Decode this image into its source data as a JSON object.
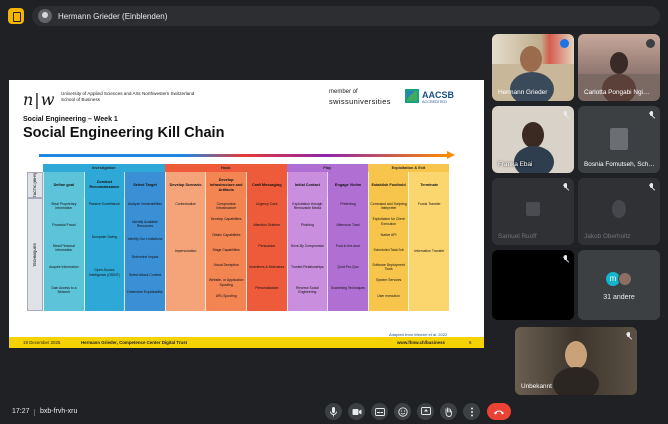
{
  "top_bar": {
    "presenter_label": "Hermann Grieder (Einblenden)"
  },
  "slide": {
    "logo": "n|w",
    "university_lines": [
      "University of Applied Sciences and Arts Northwestern Switzerland",
      "School of Business"
    ],
    "member_of": "member of",
    "swissuniversities": "swissuniversities",
    "aacsb": "AACSB",
    "aacsb_sub": "ACCREDITED",
    "subtitle": "Social Engineering – Week 1",
    "title": "Social Engineering Kill Chain",
    "side_tactic": "TACTIC (WHY)",
    "side_technique": "TECHNIQUES",
    "phases": [
      "Investigation",
      "Hook",
      "Play",
      "Exploitation & Exit"
    ],
    "columns": [
      {
        "header": "Define goal",
        "color": "#5cc3d8",
        "techniques": [
          "Steal Proprietary Information",
          "Financial Fraud",
          "Steal Personal Information",
          "Acquire Information",
          "Gain Access to a Network"
        ]
      },
      {
        "header": "Conduct Reconnaissance",
        "color": "#2ea8d6",
        "techniques": [
          "Passive Surveillance",
          "Dumpster Diving",
          "Open-Source Intelligence (OSINT)"
        ]
      },
      {
        "header": "Select Target",
        "color": "#3b8fd4",
        "techniques": [
          "Analyze Vulnerabilities",
          "Identify Available Resources",
          "Identify Our Limitations",
          "Determine Impact",
          "Select Attack Context",
          "Determine Exploitability"
        ]
      },
      {
        "header": "Develop Scenario",
        "color": "#f5a47a",
        "techniques": [
          "Contextualize",
          "Impersonation"
        ]
      },
      {
        "header": "Develop Infrastructure and Artifacts",
        "color": "#f28552",
        "techniques": [
          "Compromise Infrastructure",
          "Develop Capabilities",
          "Obtain Capabilities",
          "Stage Capabilities",
          "Visual Deception",
          "Website- or Application Spoofing",
          "URL Spoofing"
        ]
      },
      {
        "header": "Craft Messaging",
        "color": "#ee5b3a",
        "techniques": [
          "Urgency Cues",
          "Attention Grabber",
          "Persuasion",
          "Incentives & Motivators",
          "Personalization"
        ]
      },
      {
        "header": "Initial Contact",
        "color": "#c98ede",
        "techniques": [
          "Exploitation through Removable Media",
          "Phishing",
          "Drive-By Compromise",
          "Trusted Relationships",
          "Reverse Social Engineering"
        ]
      },
      {
        "header": "Engage Victim",
        "color": "#b06fd2",
        "techniques": [
          "Pretexting",
          "Afternoon Tract",
          "Foot-in-the-door",
          "Quid-Pro-Quo",
          "Scamming Techniques"
        ]
      },
      {
        "header": "Establish Foothold",
        "color": "#f7c54b",
        "techniques": [
          "Command and Scripting Interpreter",
          "Exploitation for Client Execution",
          "Native API",
          "Scheduled Task/Job",
          "Software Deployment Tools",
          "System Services",
          "User execution"
        ]
      },
      {
        "header": "Terminate",
        "color": "#fbd66e",
        "techniques": [
          "Funds Transfer",
          "Information Transfer"
        ]
      }
    ],
    "reference": "Adapted from Wenzel et al. 2022",
    "footer_date": "19 December 2025",
    "footer_author": "Hermann Grieder, Competence Center Digital Trust",
    "footer_web": "www.fhnw.ch/business",
    "footer_page": "6"
  },
  "participants": [
    {
      "name": "Hermann Grieder",
      "mic": "active"
    },
    {
      "name": "Carlotta Pongabi Ngi…",
      "mic": "on"
    },
    {
      "name": "Franka Ebai",
      "mic": "muted"
    },
    {
      "name": "Bosnia Fomutseh, Sch…",
      "mic": "muted"
    },
    {
      "name": "Samuel Ruoff",
      "mic": "muted"
    },
    {
      "name": "Jakob Oberholtz",
      "mic": "muted"
    },
    {
      "name": "",
      "mic": "muted"
    },
    {
      "name": "31 andere",
      "mic": "none",
      "avatar_letter": "m"
    },
    {
      "name": "Unbekannt",
      "mic": "muted"
    }
  ],
  "bottom_bar": {
    "time": "17:27",
    "meeting_code": "bxb-frvh-xru",
    "controls": [
      "microphone-icon",
      "camera-icon",
      "captions-icon",
      "emoji-icon",
      "present-icon",
      "raise-hand-icon",
      "more-icon",
      "hang-up-icon"
    ]
  },
  "colors": {
    "background": "#202124",
    "footer_yellow": "#f5d300",
    "hang_up": "#ea4335",
    "speaking_blue": "#1a73e8"
  }
}
